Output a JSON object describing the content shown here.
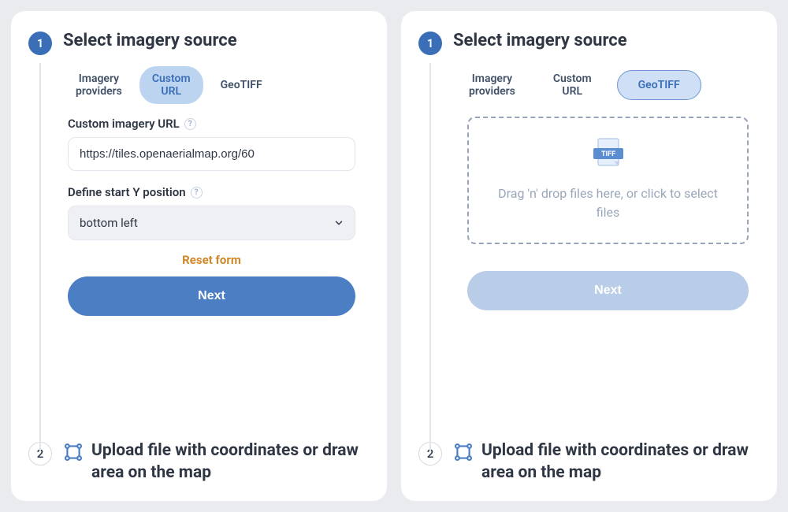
{
  "left": {
    "step1": {
      "number": "1",
      "title": "Select imagery source",
      "tabs": {
        "providers": "Imagery\nproviders",
        "custom_url": "Custom\nURL",
        "geotiff": "GeoTIFF"
      },
      "url_field": {
        "label": "Custom imagery URL",
        "value": "https://tiles.openaerialmap.org/60"
      },
      "ypos_field": {
        "label": "Define start Y position",
        "value": "bottom left"
      },
      "reset": "Reset form",
      "next": "Next"
    },
    "step2": {
      "number": "2",
      "title": "Upload file with coordinates or draw area on the map"
    }
  },
  "right": {
    "step1": {
      "number": "1",
      "title": "Select imagery source",
      "tabs": {
        "providers": "Imagery\nproviders",
        "custom_url": "Custom\nURL",
        "geotiff": "GeoTIFF"
      },
      "dropzone": {
        "badge": "TIFF",
        "text": "Drag 'n' drop files here, or click to select files"
      },
      "next": "Next"
    },
    "step2": {
      "number": "2",
      "title": "Upload file with coordinates or draw area on the map"
    }
  }
}
